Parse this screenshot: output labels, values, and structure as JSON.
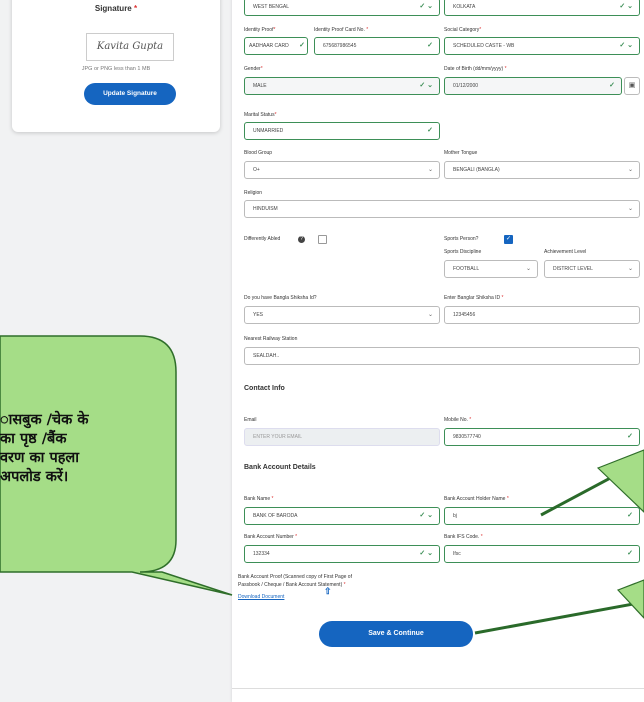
{
  "signature": {
    "title": "Signature",
    "required": "*",
    "image_text": "Kavita Gupta",
    "note": "JPG or PNG less than 1 MB",
    "update_label": "Update Signature"
  },
  "top_row": {
    "state": "WEST BENGAL",
    "district": "KOLKATA"
  },
  "identity": {
    "proof_label": "Identity Proof",
    "proof_value": "AADHAAR CARD",
    "card_label": "Identity Proof Card No.",
    "card_value": "675687986545",
    "category_label": "Social Category",
    "category_value": "SCHEDULED CASTE - WB"
  },
  "gender": {
    "label": "Gender",
    "value": "MALE"
  },
  "dob": {
    "label": "Date of Birth (dd/mm/yyyy)",
    "value": "01/12/2000"
  },
  "marital": {
    "label": "Marital Status",
    "value": "UNMARRIED"
  },
  "blood": {
    "label": "Blood Group",
    "value": "O+"
  },
  "tongue": {
    "label": "Mother Tongue",
    "value": "BENGALI (BANGLA)"
  },
  "religion": {
    "label": "Religion",
    "value": "HINDUISM"
  },
  "disabled": {
    "label": "Differently Abled"
  },
  "sports": {
    "label": "Sports Person?",
    "discipline_label": "Sports Discipline",
    "discipline_value": "FOOTBALL",
    "level_label": "Achievement Level",
    "level_value": "DISTRICT LEVEL"
  },
  "bangla": {
    "label": "Do you have Bangla Shiksha Id?",
    "value": "YES",
    "id_label": "Enter Banglar Shiksha ID",
    "id_value": "12345456"
  },
  "railway": {
    "label": "Nearest Railway Station",
    "value": "SEALDAH.."
  },
  "contact": {
    "heading": "Contact Info",
    "email_label": "Email",
    "email_placeholder": "ENTER YOUR EMAIL",
    "mobile_label": "Mobile No.",
    "mobile_value": "9830577740"
  },
  "bank": {
    "heading": "Bank Account Details",
    "name_label": "Bank Name",
    "name_value": "BANK OF BARODA",
    "holder_label": "Bank Account Holder Name",
    "holder_value": "bj",
    "number_label": "Bank Account Number",
    "number_value": "132334",
    "ifsc_label": "Bank IFS Code.",
    "ifsc_value": "Ifsc",
    "proof_label_1": "Bank Account Proof (Scanned copy of First Page of",
    "proof_label_2": "Passbook / Cheque / Bank Account Statement)",
    "download_label": "Download Document"
  },
  "save_label": "Save & Continue",
  "req": "*",
  "callout": {
    "line1": "ासबुक /चेक के",
    "line2": "का पृष्ठ /बैंक",
    "line3": "वरण का पहला",
    "line4": "अपलोड करें।"
  },
  "colors": {
    "primary": "#1565c0",
    "valid": "#3d8f57",
    "bubble": "#a5dd87"
  }
}
